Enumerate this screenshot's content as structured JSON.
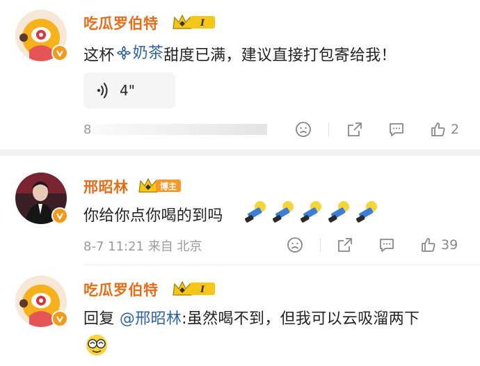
{
  "comments": [
    {
      "username": "吃瓜罗伯特",
      "level_badge": "I",
      "text_prefix": "这杯",
      "topic_icon": "topic-flower-icon",
      "topic": "奶茶",
      "text_suffix": "甜度已满，建议直接打包寄给我！",
      "voice_duration": "4\"",
      "meta_left": "8",
      "like_count": "2"
    },
    {
      "username": "邢昭林",
      "role_badge": "博主",
      "text": "你给你点你喝的到吗",
      "emoji_count_visual": "5",
      "timestamp": "8-7 11:21 来自 北京",
      "like_count": "39"
    },
    {
      "username": "吃瓜罗伯特",
      "level_badge": "I",
      "reply_prefix": "回复 ",
      "mention": "@邢昭林",
      "reply_text": ":虽然喝不到，但我可以云吸溜两下"
    }
  ],
  "colors": {
    "username": "#e86c15",
    "mention": "#2d62a8",
    "badge_gold": "#f5c518",
    "vip": "#f49a1a"
  }
}
